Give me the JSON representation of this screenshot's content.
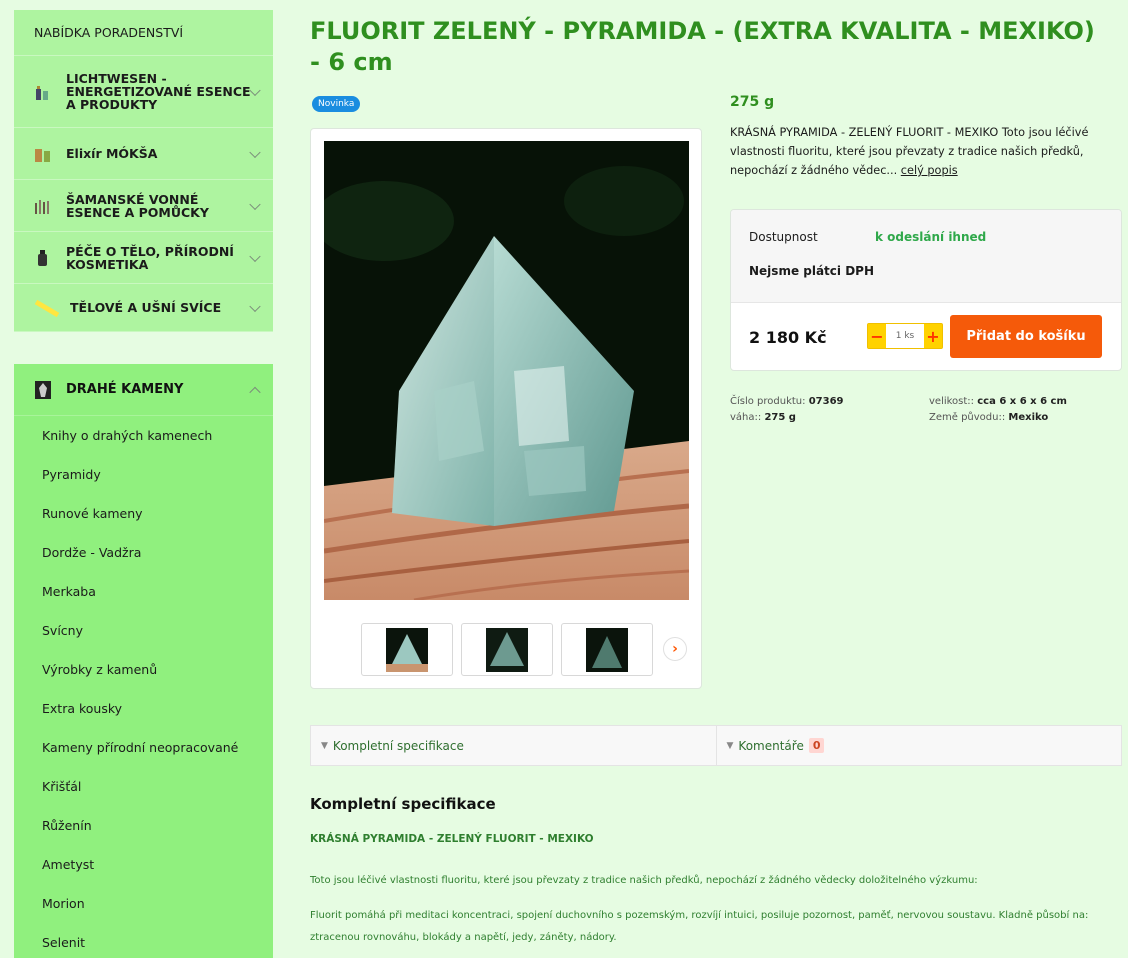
{
  "sidebar": {
    "top_menu": [
      {
        "label": "NABÍDKA PORADENSTVÍ"
      },
      {
        "label": "LICHTWESEN - ENERGETIZOVANÉ ESENCE A PRODUKTY"
      },
      {
        "label": "Elixír MÓKŠA"
      },
      {
        "label": "ŠAMANSKÉ VONNÉ ESENCE a POMŮCKY"
      },
      {
        "label": "PÉČE O TĚLO, PŘÍRODNÍ KOSMETIKA"
      },
      {
        "label": "TĚLOVÉ A UŠNÍ SVÍCE"
      }
    ],
    "stones": {
      "label": "DRAHÉ KAMENY",
      "items": [
        "Knihy o drahých kamenech",
        "Pyramidy",
        "Runové kameny",
        "Dordže - Vadžra",
        "Merkaba",
        "Svícny",
        "Výrobky z kamenů",
        "Extra kousky",
        "Kameny přírodní neopracované",
        "Křišťál",
        "Růženín",
        "Ametyst",
        "Morion",
        "Selenit"
      ]
    }
  },
  "product": {
    "title": "FLUORIT ZELENÝ - PYRAMIDA - (EXTRA KVALITA - MEXIKO) - 6 cm",
    "badge": "Novinka",
    "weight": "275 g",
    "short_desc": "KRÁSNÁ PYRAMIDA - ZELENÝ FLUORIT - MEXIKO Toto jsou léčivé vlastnosti fluoritu, které jsou převzaty z tradice našich předků, nepochází z žádného vědec...",
    "full_desc_link": "celý popis",
    "availability_label": "Dostupnost",
    "availability_value": "k odeslání ihned",
    "vat_note": "Nejsme plátci DPH",
    "price": "2 180 Kč",
    "qty": "1 ks",
    "qty_minus": "−",
    "qty_plus": "+",
    "cart_button": "Přidat do košíku",
    "meta": {
      "code_label": "Číslo produktu:",
      "code_value": "07369",
      "weight_label": "váha::",
      "weight_value": "275 g",
      "size_label": "velikost::",
      "size_value": "cca 6 x 6 x 6 cm",
      "origin_label": "Země původu::",
      "origin_value": "Mexiko"
    }
  },
  "tabs": {
    "spec": "Kompletní specifikace",
    "comments": "Komentáře",
    "comments_count": "0"
  },
  "spec": {
    "heading": "Kompletní specifikace",
    "subheading": "KRÁSNÁ PYRAMIDA - ZELENÝ FLUORIT - MEXIKO",
    "p1": "Toto jsou léčivé vlastnosti fluoritu, které jsou převzaty z tradice našich předků, nepochází z žádného vědecky doložitelného výzkumu:",
    "p2a": "Fluorit pomáhá při meditaci koncentraci, spojení duchovního s pozemským, rozvíjí intuici, posiluje pozornost, paměť, nervovou soustavu. Kladně působí na:",
    "p2b": "ztracenou rovnováhu, blokády a napětí, jedy, záněty, nádory."
  },
  "colors": {
    "page_bg": "#e6fce2",
    "menu_bg": "#aef4a0",
    "stones_bg": "#90f07e",
    "title_green": "#2f8f1f",
    "cart_orange": "#f55a0a",
    "badge_blue": "#1a8de0"
  },
  "icons": {
    "next": "chevron-right-icon",
    "expand": "chevron-down-icon",
    "collapse": "chevron-up-icon"
  }
}
